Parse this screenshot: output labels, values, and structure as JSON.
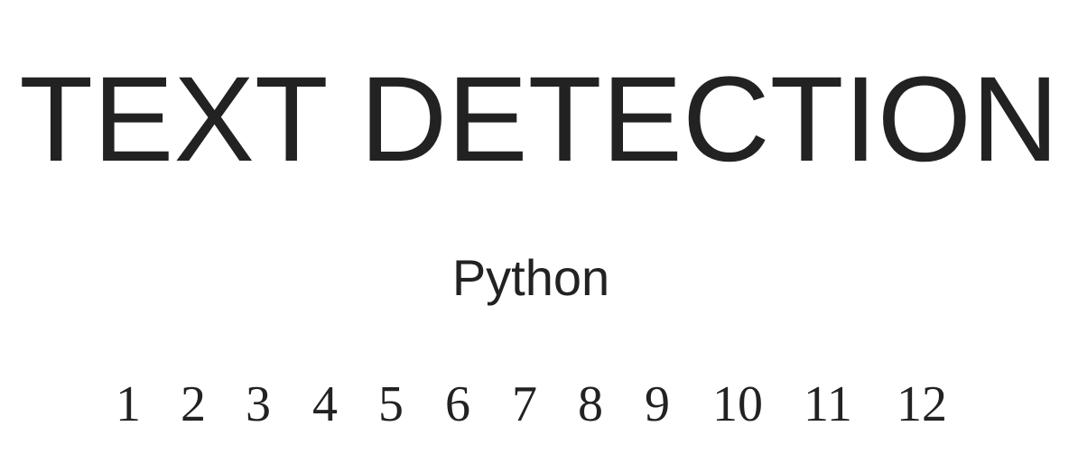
{
  "title": "TEXT DETECTION",
  "subtitle": "Python",
  "numbers": [
    "1",
    "2",
    "3",
    "4",
    "5",
    "6",
    "7",
    "8",
    "9",
    "10",
    "11",
    "12"
  ]
}
